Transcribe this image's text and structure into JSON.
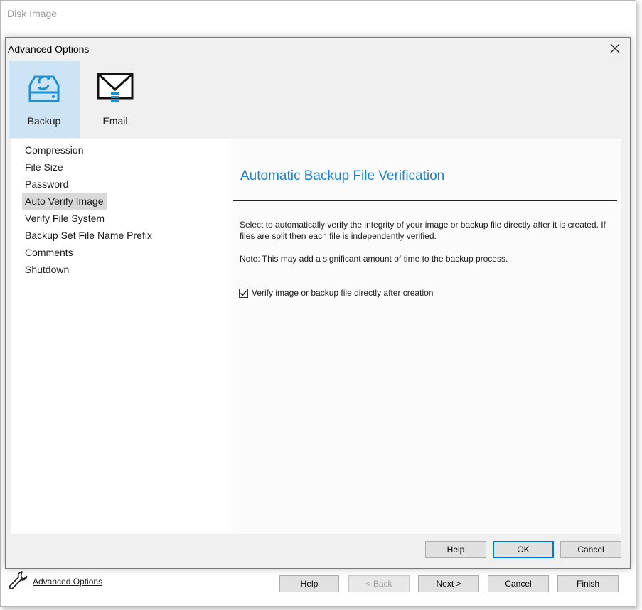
{
  "parent": {
    "title": "Disk Image",
    "advanced_options_link": "Advanced Options",
    "buttons": {
      "help": "Help",
      "back": "< Back",
      "next": "Next >",
      "cancel": "Cancel",
      "finish": "Finish"
    }
  },
  "dialog": {
    "title": "Advanced Options",
    "categories": [
      {
        "label": "Backup",
        "icon": "backup-drive-icon",
        "selected": true
      },
      {
        "label": "Email",
        "icon": "email-icon",
        "selected": false
      }
    ],
    "nav_items": [
      "Compression",
      "File Size",
      "Password",
      "Auto Verify Image",
      "Verify File System",
      "Backup Set File Name Prefix",
      "Comments",
      "Shutdown"
    ],
    "selected_nav": "Auto Verify Image",
    "panel": {
      "heading": "Automatic Backup File Verification",
      "description": "Select to automatically verify the integrity of your image or backup file directly after it is created. If files are split then each file is independently verified.",
      "note": "Note: This may add a significant amount of time to the backup process.",
      "checkbox_label": "Verify image or backup file directly after creation",
      "checkbox_checked": true
    },
    "buttons": {
      "help": "Help",
      "ok": "OK",
      "cancel": "Cancel"
    }
  },
  "colors": {
    "accent": "#1f7fc8",
    "selected_category_bg": "#cde4f7",
    "selected_nav_bg": "#d9d9d9",
    "default_button_border": "#0078d7"
  }
}
